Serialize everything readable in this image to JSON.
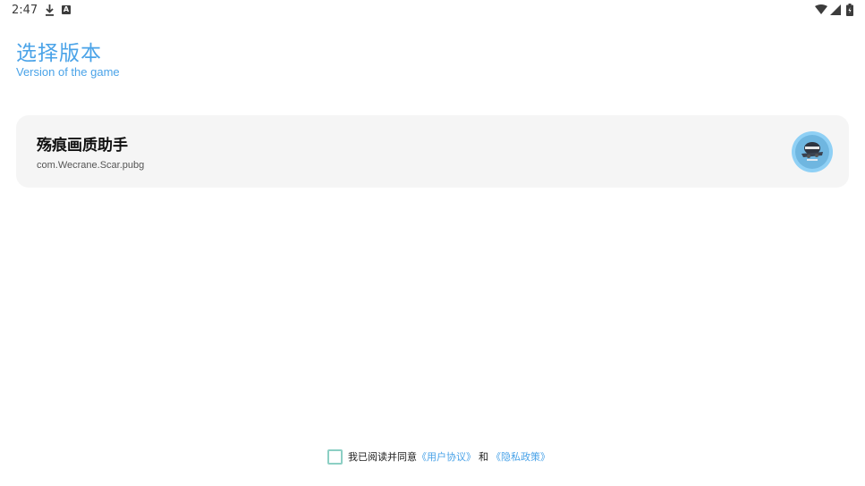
{
  "status_bar": {
    "time": "2:47",
    "notification_icons": [
      "download-icon",
      "a-icon"
    ],
    "system_icons": [
      "wifi-icon",
      "signal-icon",
      "battery-icon"
    ]
  },
  "header": {
    "title": "选择版本",
    "subtitle": "Version of the game"
  },
  "versions": [
    {
      "name": "殇痕画质助手",
      "package": "com.Wecrane.Scar.pubg",
      "icon": "app-icon"
    }
  ],
  "agreement": {
    "prefix": "我已阅读并同意",
    "user_agreement": "《用户协议》",
    "conjunction": "和",
    "privacy_policy": "《隐私政策》",
    "checked": false
  },
  "colors": {
    "accent": "#4aa3e8",
    "card_bg": "#f5f5f5",
    "checkbox_border": "#8ccfc4"
  }
}
